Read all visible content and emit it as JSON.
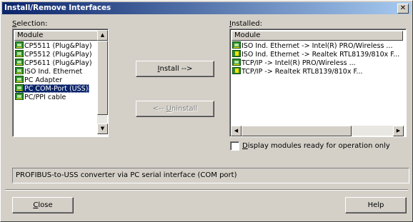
{
  "window": {
    "title": "Install/Remove Interfaces",
    "close_glyph": "✕"
  },
  "selection": {
    "label": "Selection:",
    "column_header": "Module",
    "items": [
      {
        "label": "CP5511 (Plug&Play)",
        "icon": "module-icon"
      },
      {
        "label": "CP5512 (Plug&Play)",
        "icon": "module-icon"
      },
      {
        "label": "CP5611 (Plug&Play)",
        "icon": "module-icon"
      },
      {
        "label": "ISO Ind. Ethernet",
        "icon": "module-icon"
      },
      {
        "label": "PC Adapter",
        "icon": "module-icon"
      },
      {
        "label": "PC COM-Port (USS)",
        "icon": "module-icon",
        "selected": true
      },
      {
        "label": "PC/PPI cable",
        "icon": "module-icon"
      }
    ]
  },
  "installed": {
    "label": "Installed:",
    "column_header": "Module",
    "items": [
      {
        "label": "ISO Ind. Ethernet -> Intel(R) PRO/Wireless ...",
        "icon": "module-icon"
      },
      {
        "label": "ISO Ind. Ethernet -> Realtek RTL8139/810x F...",
        "icon": "network-icon"
      },
      {
        "label": "TCP/IP -> Intel(R) PRO/Wireless ...",
        "icon": "module-icon"
      },
      {
        "label": "TCP/IP -> Realtek RTL8139/810x F...",
        "icon": "network-icon"
      }
    ]
  },
  "buttons": {
    "install": "Install -->",
    "uninstall": "<-- Uninstall",
    "close": "Close",
    "help": "Help"
  },
  "checkbox": {
    "label": "Display modules ready for operation only",
    "checked": false
  },
  "description": "PROFIBUS-to-USS converter via PC serial interface (COM port)",
  "colors": {
    "title_start": "#0a246a",
    "title_end": "#a6caf0",
    "selection_bg": "#0a246a",
    "face": "#d4d0c8"
  }
}
